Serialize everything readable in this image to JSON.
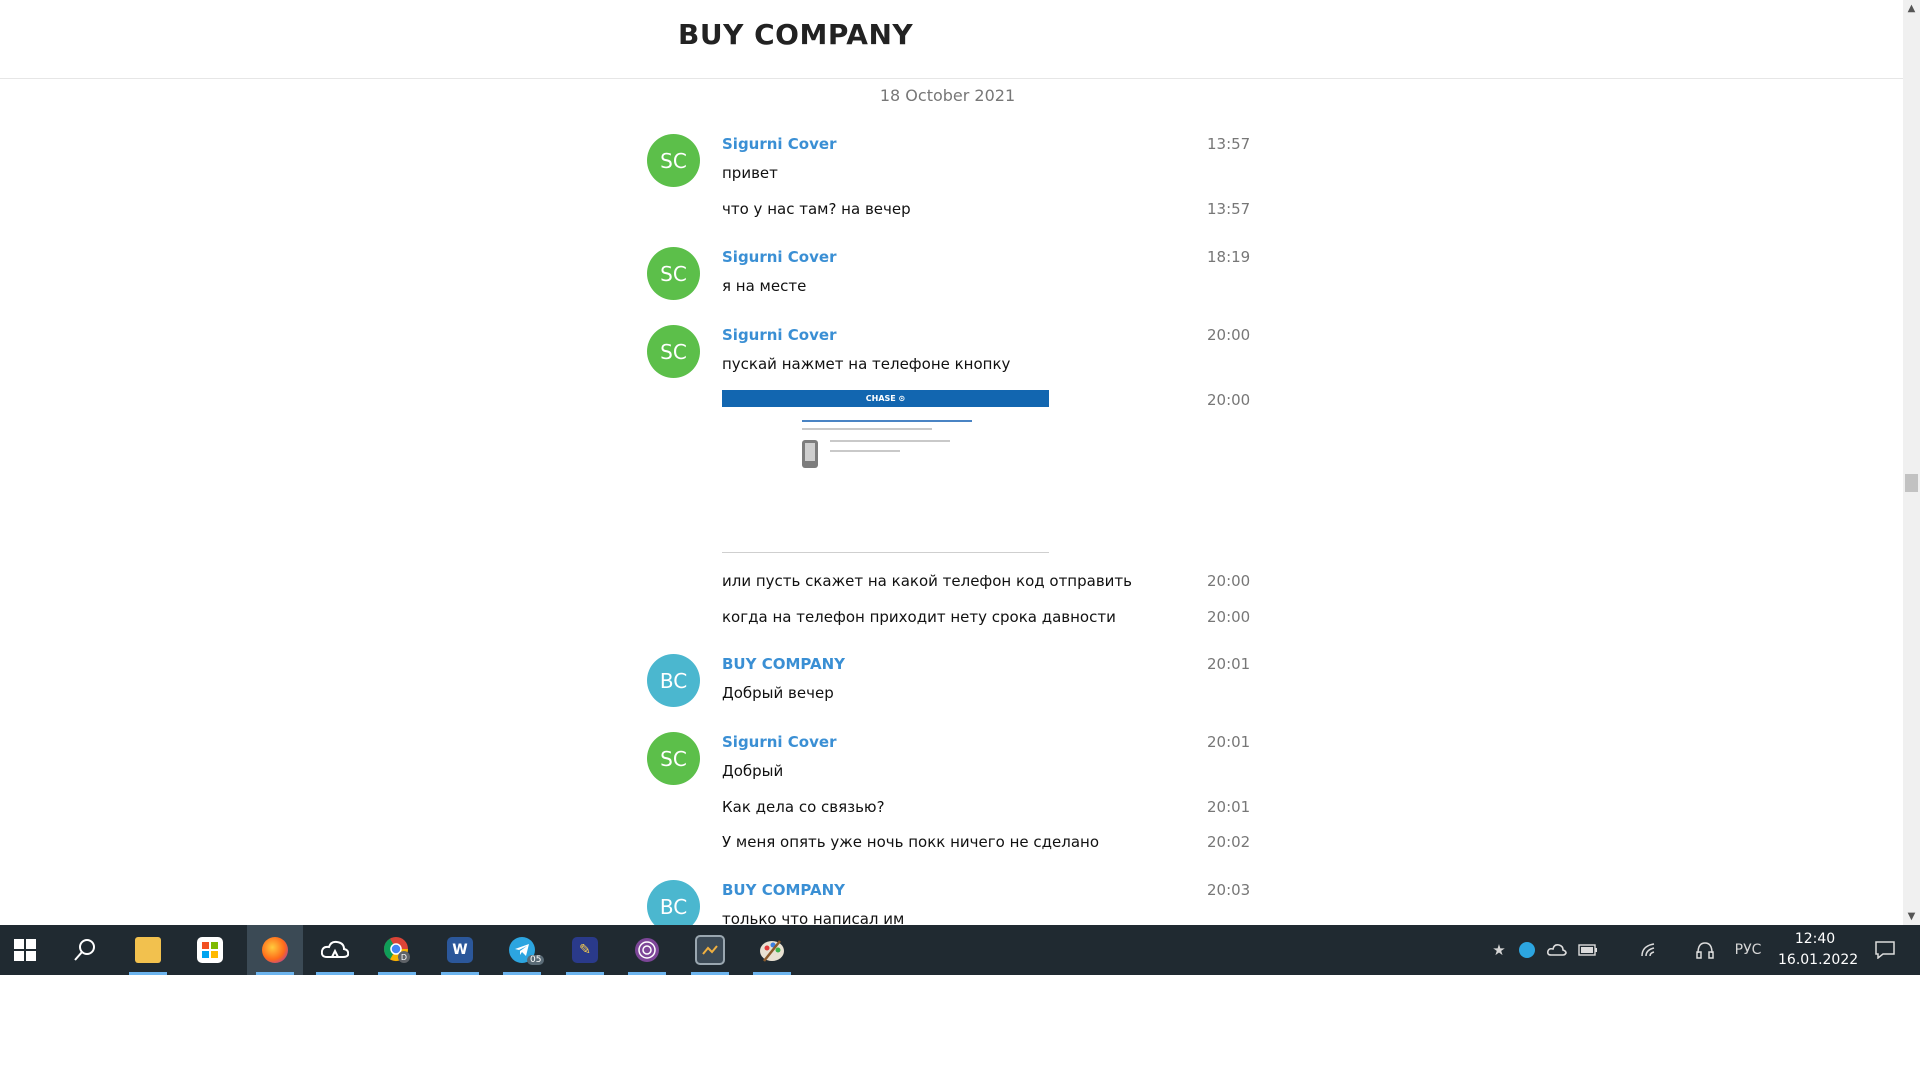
{
  "chat": {
    "title": "BUY COMPANY",
    "date_divider": "18 October 2021",
    "photo_brand": "CHASE"
  },
  "messages": [
    {
      "avatar": "SC",
      "sender": "Sigurni Cover",
      "time": "13:57",
      "text": "привет"
    },
    {
      "text": "что у нас там? на вечер",
      "time": "13:57"
    },
    {
      "avatar": "SC",
      "sender": "Sigurni Cover",
      "time": "18:19",
      "text": "я на месте"
    },
    {
      "avatar": "SC",
      "sender": "Sigurni Cover",
      "time": "20:00",
      "text": "пускай нажмет на телефоне кнопку"
    },
    {
      "photo_time": "20:00"
    },
    {
      "text": "или пусть скажет на какой телефон код отправить",
      "time": "20:00"
    },
    {
      "text": "когда на телефон приходит нету срока давности",
      "time": "20:00"
    },
    {
      "avatar": "BC",
      "sender": "BUY COMPANY",
      "time": "20:01",
      "text": "Добрый вечер"
    },
    {
      "avatar": "SC",
      "sender": "Sigurni Cover",
      "time": "20:01",
      "text": "Добрый"
    },
    {
      "text": "Как дела со связью?",
      "time": "20:01"
    },
    {
      "text": "У меня опять уже ночь покк ничего не сделано",
      "time": "20:02"
    },
    {
      "avatar": "BC",
      "sender": "BUY COMPANY",
      "time": "20:03",
      "text": "только что написал им"
    }
  ],
  "colors": {
    "avatar_sc": "#5cbf4a",
    "avatar_bc": "#4bb7cf",
    "sender_name": "#3a8fd4",
    "taskbar": "#202a31"
  },
  "taskbar": {
    "apps": [
      {
        "name": "windows-start-icon"
      },
      {
        "name": "search-icon"
      },
      {
        "name": "file-explorer-icon"
      },
      {
        "name": "store-icon"
      },
      {
        "name": "firefox-icon"
      },
      {
        "name": "cloud-icon"
      },
      {
        "name": "chrome-icon"
      },
      {
        "name": "word-icon",
        "label": "W"
      },
      {
        "name": "telegram-icon",
        "badge": "05"
      },
      {
        "name": "editor-icon"
      },
      {
        "name": "tor-icon"
      },
      {
        "name": "app-icon"
      },
      {
        "name": "paint-icon"
      }
    ],
    "language": "РУС",
    "clock_time": "12:40",
    "clock_date": "16.01.2022"
  }
}
